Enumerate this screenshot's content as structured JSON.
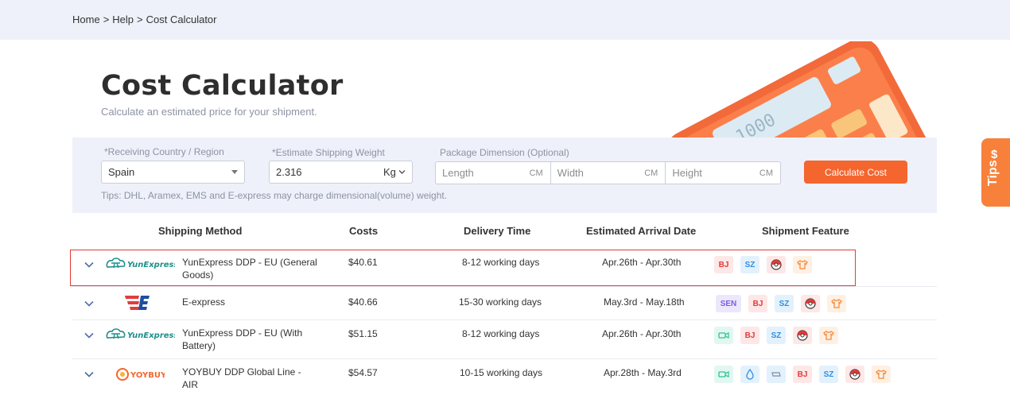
{
  "breadcrumb": [
    "Home",
    ">",
    "Help",
    ">",
    "Cost Calculator"
  ],
  "page": {
    "title": "Cost Calculator",
    "subtitle": "Calculate an estimated price for your shipment.",
    "calculator_display": "1000"
  },
  "form": {
    "country_label": "*Receiving Country / Region",
    "country_value": "Spain",
    "weight_label": "*Estimate Shipping Weight",
    "weight_value": "2.316",
    "weight_unit": "Kg",
    "dimension_label": "Package Dimension (Optional)",
    "length_placeholder": "Length",
    "width_placeholder": "Width",
    "height_placeholder": "Height",
    "dimension_unit": "CM",
    "calculate_label": "Calculate Cost",
    "tips_text": "Tips: DHL, Aramex, EMS and E-express may charge dimensional(volume) weight."
  },
  "table": {
    "headers": [
      "Shipping Method",
      "Costs",
      "Delivery Time",
      "Estimated Arrival Date",
      "Shipment Feature"
    ],
    "rows": [
      {
        "logo_name": "yunexpress-logo",
        "logo_text": "YunExpress",
        "method": "YunExpress DDP - EU (General Goods)",
        "cost": "$40.61",
        "delivery": "8-12 working days",
        "arrival": "Apr.26th - Apr.30th",
        "features": [
          "BJ",
          "SZ",
          "ball",
          "shirt"
        ]
      },
      {
        "logo_name": "e-express-logo",
        "logo_text": "",
        "method": "E-express",
        "cost": "$40.66",
        "delivery": "15-30 working days",
        "arrival": "May.3rd - May.18th",
        "features": [
          "SEN",
          "BJ",
          "SZ",
          "ball",
          "shirt"
        ]
      },
      {
        "logo_name": "yunexpress-logo",
        "logo_text": "YunExpress",
        "method": "YunExpress DDP - EU (With Battery)",
        "cost": "$51.15",
        "delivery": "8-12 working days",
        "arrival": "Apr.26th - Apr.30th",
        "features": [
          "camera",
          "BJ",
          "SZ",
          "ball",
          "shirt"
        ]
      },
      {
        "logo_name": "yoybuy-logo",
        "logo_text": "YOYBUY",
        "method": "YOYBUY DDP Global Line - AIR",
        "cost": "$54.57",
        "delivery": "10-15 working days",
        "arrival": "Apr.28th - May.3rd",
        "features": [
          "camera",
          "drop",
          "battery",
          "BJ",
          "SZ",
          "ball",
          "shirt"
        ]
      }
    ]
  },
  "tips_tab": {
    "icon": "$",
    "label": "Tips"
  },
  "colors": {
    "accent": "#f5652e",
    "panel": "#eef1f9",
    "highlight": "#e53935"
  }
}
